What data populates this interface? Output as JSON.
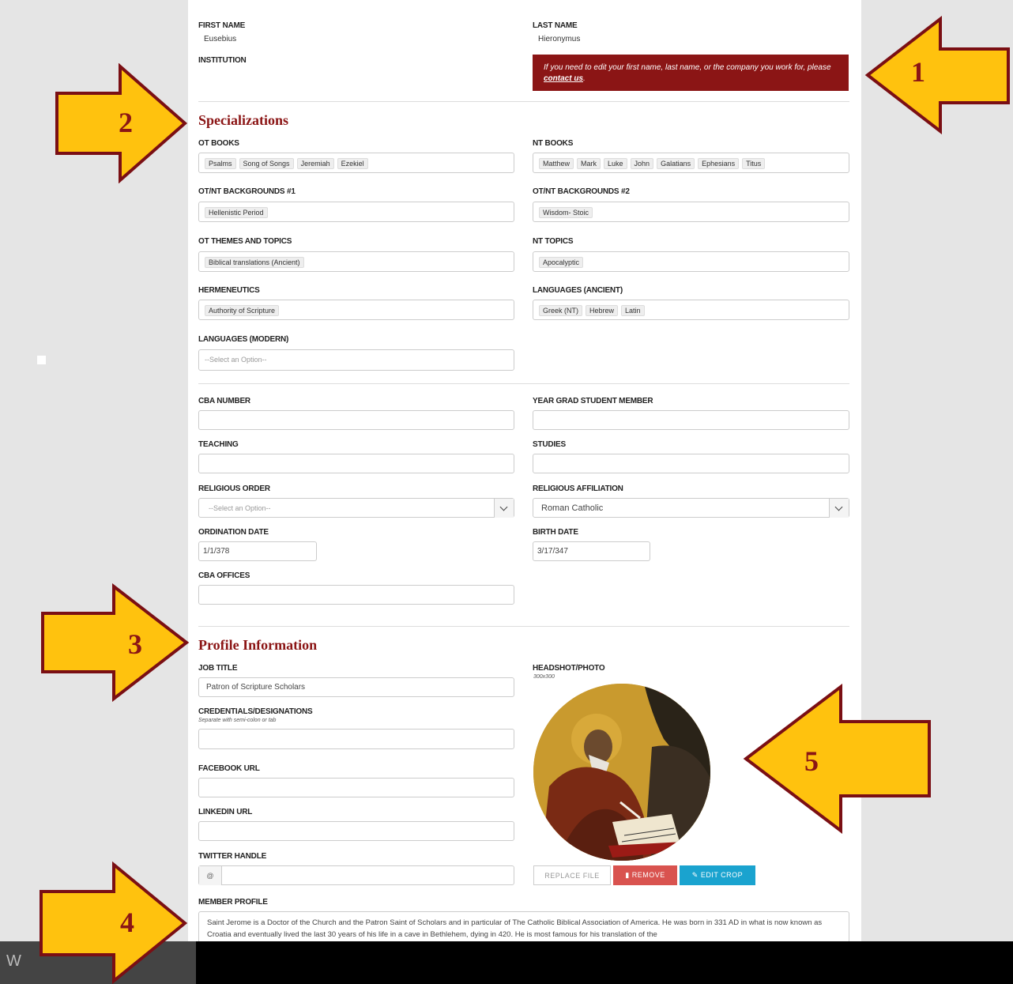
{
  "header": {
    "first_name_label": "FIRST NAME",
    "first_name": "Eusebius",
    "last_name_label": "LAST NAME",
    "last_name": "Hieronymus",
    "institution_label": "INSTITUTION",
    "notice_text": "If you need to edit your first name, last name, or the company you work for, please",
    "notice_link": "contact us",
    "notice_end": "."
  },
  "specializations": {
    "title": "Specializations",
    "ot_books_label": "OT BOOKS",
    "ot_books": [
      "Psalms",
      "Song of Songs",
      "Jeremiah",
      "Ezekiel"
    ],
    "nt_books_label": "NT BOOKS",
    "nt_books": [
      "Matthew",
      "Mark",
      "Luke",
      "John",
      "Galatians",
      "Ephesians",
      "Titus"
    ],
    "bg1_label": "OT/NT BACKGROUNDS #1",
    "bg1": [
      "Hellenistic Period"
    ],
    "bg2_label": "OT/NT BACKGROUNDS #2",
    "bg2": [
      "Wisdom- Stoic"
    ],
    "ot_themes_label": "OT THEMES AND TOPICS",
    "ot_themes": [
      "Biblical translations (Ancient)"
    ],
    "nt_topics_label": "NT TOPICS",
    "nt_topics": [
      "Apocalyptic"
    ],
    "hermeneutics_label": "HERMENEUTICS",
    "hermeneutics": [
      "Authority of Scripture"
    ],
    "lang_ancient_label": "LANGUAGES (ANCIENT)",
    "lang_ancient": [
      "Greek (NT)",
      "Hebrew",
      "Latin"
    ],
    "lang_modern_label": "LANGUAGES (MODERN)",
    "lang_modern_placeholder": "--Select an Option--"
  },
  "member": {
    "cba_number_label": "CBA NUMBER",
    "year_grad_label": "YEAR GRAD STUDENT MEMBER",
    "teaching_label": "TEACHING",
    "studies_label": "STUDIES",
    "religious_order_label": "RELIGIOUS ORDER",
    "religious_order_value": "--Select an Option--",
    "religious_affiliation_label": "RELIGIOUS AFFILIATION",
    "religious_affiliation_value": "Roman Catholic",
    "ordination_label": "ORDINATION DATE",
    "ordination_value": "1/1/378",
    "birth_label": "BIRTH DATE",
    "birth_value": "3/17/347",
    "cba_offices_label": "CBA OFFICES"
  },
  "profile": {
    "title": "Profile Information",
    "job_title_label": "JOB TITLE",
    "job_title_value": "Patron of Scripture Scholars",
    "credentials_label": "CREDENTIALS/DESIGNATIONS",
    "credentials_hint": "Separate with semi-colon or tab",
    "facebook_label": "FACEBOOK URL",
    "linkedin_label": "LINKEDIN URL",
    "twitter_label": "TWITTER HANDLE",
    "twitter_prefix": "@",
    "headshot_label": "HEADSHOT/PHOTO",
    "headshot_hint": "300x300",
    "replace_label": "REPLACE FILE",
    "remove_label": "REMOVE",
    "edit_crop_label": "EDIT CROP",
    "member_profile_label": "MEMBER PROFILE",
    "member_profile_text": "Saint Jerome is a Doctor of the Church and the Patron Saint of Scholars and in particular of The Catholic Biblical Association of America. He was born in 331 AD in what is now known as Croatia and eventually lived the last 30 years of his life in a cave in Bethlehem, dying in 420.  He is most famous for his translation of the"
  },
  "annotations": {
    "arrow1": "1",
    "arrow2": "2",
    "arrow3": "3",
    "arrow4": "4",
    "arrow5": "5",
    "fill": "#ffc20e",
    "stroke": "#7a0f14"
  },
  "footer": {
    "left_char": "W"
  }
}
